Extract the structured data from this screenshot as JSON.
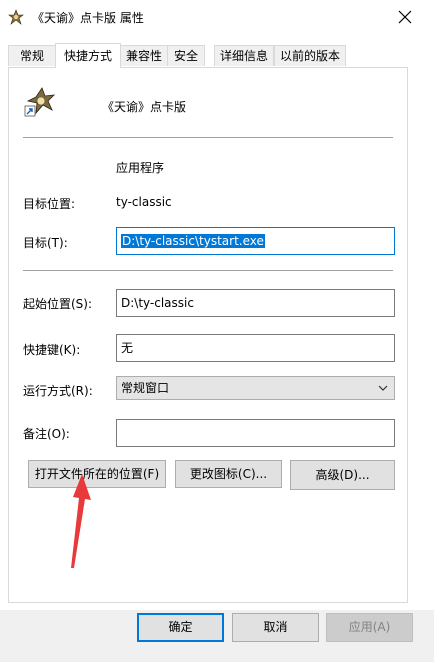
{
  "window": {
    "title": "《天谕》点卡版 属性"
  },
  "tabs": [
    {
      "label": "常规"
    },
    {
      "label": "快捷方式"
    },
    {
      "label": "兼容性"
    },
    {
      "label": "安全"
    },
    {
      "label": "详细信息"
    },
    {
      "label": "以前的版本"
    }
  ],
  "shortcut": {
    "name": "《天谕》点卡版",
    "target_type_value": "应用程序",
    "target_location_label": "目标位置:",
    "target_location_value": "ty-classic",
    "target_label": "目标(T):",
    "target_value": "D:\\ty-classic\\tystart.exe",
    "start_in_label": "起始位置(S):",
    "start_in_value": "D:\\ty-classic",
    "shortcut_key_label": "快捷键(K):",
    "shortcut_key_value": "无",
    "run_label": "运行方式(R):",
    "run_value": "常规窗口",
    "comment_label": "备注(O):",
    "comment_value": ""
  },
  "buttons": {
    "open_location": "打开文件所在的位置(F)",
    "change_icon": "更改图标(C)...",
    "advanced": "高级(D)...",
    "ok": "确定",
    "cancel": "取消",
    "apply": "应用(A)"
  },
  "colors": {
    "accent": "#0078d7",
    "annotation_arrow": "#e83a3a"
  }
}
